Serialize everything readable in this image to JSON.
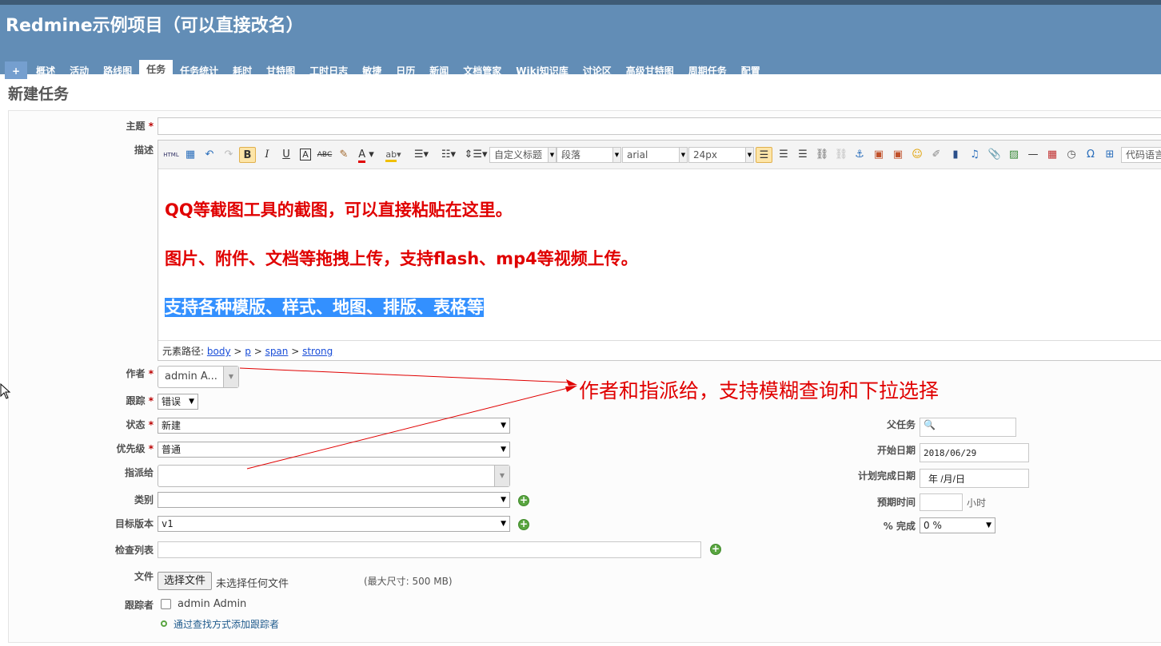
{
  "header": {
    "title": "Redmine示例项目（可以直接改名）"
  },
  "menu": {
    "plus": "+",
    "items": [
      "概述",
      "活动",
      "路线图",
      "任务",
      "任务统计",
      "耗时",
      "甘特图",
      "工时日志",
      "敏捷",
      "日历",
      "新闻",
      "文档管家",
      "Wiki知识库",
      "讨论区",
      "高级甘特图",
      "周期任务",
      "配置"
    ],
    "selected": "任务"
  },
  "page": {
    "title": "新建任务"
  },
  "form": {
    "subject_label": "主题",
    "subject_value": "",
    "description_label": "描述",
    "required_mark": "*",
    "editor": {
      "toolbar": {
        "html": "HTML",
        "custom_heading": "自定义标题",
        "paragraph": "段落",
        "font": "arial",
        "size": "24px",
        "code_lang": "代码语言"
      },
      "lines": [
        "QQ等截图工具的截图，可以直接粘贴在这里。",
        "图片、附件、文档等拖拽上传，支持flash、mp4等视频上传。",
        "支持各种模版、样式、地图、排版、表格等"
      ],
      "path_label": "元素路径:",
      "path": [
        "body",
        "p",
        "span",
        "strong"
      ]
    },
    "author_label": "作者",
    "author_value": "admin A...",
    "tracker_label": "跟踪",
    "tracker_value": "错误",
    "status_label": "状态",
    "status_value": "新建",
    "priority_label": "优先级",
    "priority_value": "普通",
    "assignee_label": "指派给",
    "assignee_value": "",
    "category_label": "类别",
    "category_value": "",
    "version_label": "目标版本",
    "version_value": "v1",
    "checklist_label": "检查列表",
    "parent_label": "父任务",
    "start_label": "开始日期",
    "start_value": "2018/06/29",
    "due_label": "计划完成日期",
    "due_value": "年 /月/日",
    "estimate_label": "预期时间",
    "estimate_unit": "小时",
    "done_label": "% 完成",
    "done_value": "0 %",
    "file_label": "文件",
    "file_button": "选择文件",
    "file_status": "未选择任何文件",
    "file_max": "(最大尺寸: 500 MB)",
    "watchers_label": "跟踪者",
    "watcher_name": "admin Admin",
    "add_watchers_link": "通过查找方式添加跟踪者"
  },
  "annotation": {
    "text": "作者和指派给，支持模糊查询和下拉选择"
  },
  "colors": {
    "header": "#628db6",
    "annotation": "#e00000",
    "highlight": "#3390ff"
  }
}
